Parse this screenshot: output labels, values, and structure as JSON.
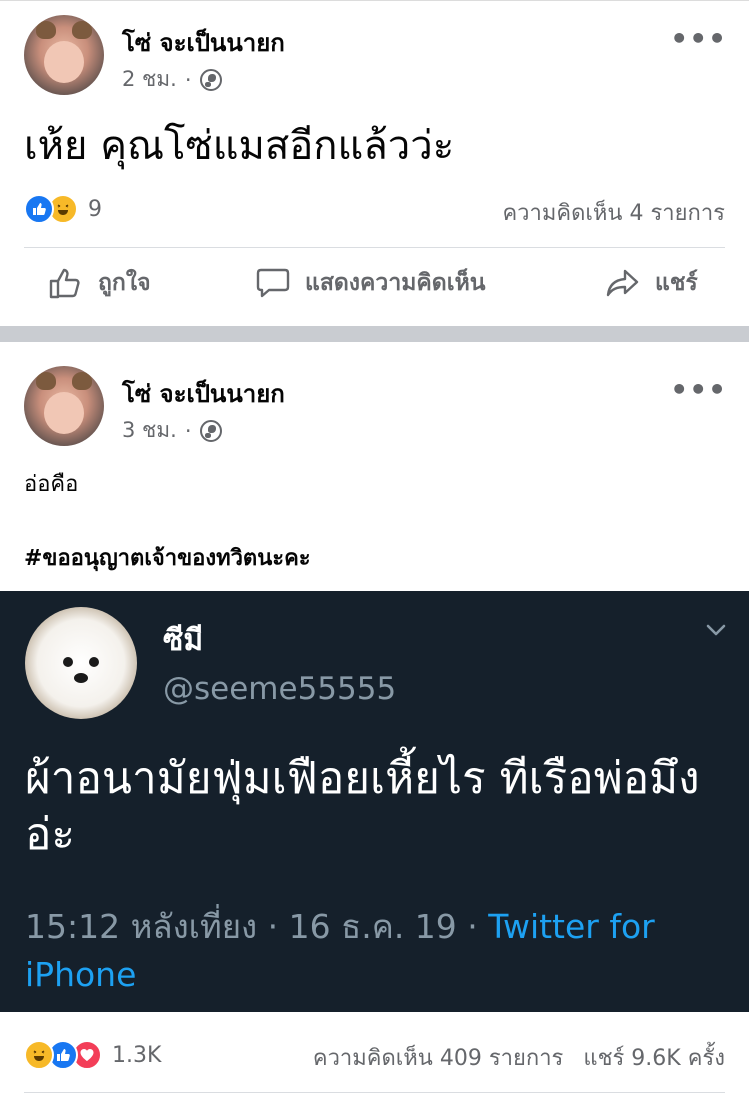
{
  "posts": [
    {
      "author": "โซ่ จะเป็นนายก",
      "time": "2 ชม.",
      "separator": "·",
      "text": "เห้ย คุณโซ่แมสอีกแล้วว่ะ",
      "reaction_count": "9",
      "comments_label": "ความคิดเห็น 4 รายการ",
      "reactions": [
        "like",
        "haha"
      ]
    },
    {
      "author": "โซ่ จะเป็นนายก",
      "time": "3 ชม.",
      "separator": "·",
      "text_line1": "อ่อคือ",
      "hashtag": "#ขออนุญาตเจ้าของทวิตนะคะ",
      "reaction_count": "1.3K",
      "comments_label": "ความคิดเห็น 409 รายการ",
      "shares_label": "แชร์ 9.6K ครั้ง",
      "reactions": [
        "haha",
        "like",
        "love"
      ]
    }
  ],
  "actions": {
    "like": "ถูกใจ",
    "comment": "แสดงความคิดเห็น",
    "share": "แชร์"
  },
  "more_label": "•••",
  "tweet": {
    "name": "ซีมี",
    "handle": "@seeme55555",
    "text": "ผ้าอนามัยฟุ่มเฟือยเหี้ยไร ทีเรือพ่อมึงอ่ะ",
    "meta": "15:12 หลังเที่ยง · 16 ธ.ค. 19 · ",
    "source": "Twitter for iPhone"
  },
  "colors": {
    "like_blue": "#1877f2",
    "haha_yellow": "#f7b928",
    "love_red": "#f33e58",
    "tweet_bg": "#15202b",
    "twitter_blue": "#1da1f2",
    "divider": "#c9ccd1"
  }
}
